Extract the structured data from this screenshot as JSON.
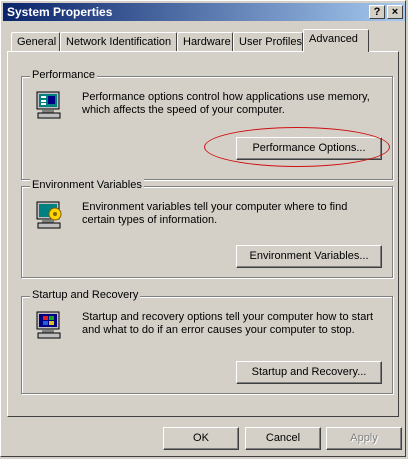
{
  "window": {
    "title": "System Properties",
    "help_label": "?",
    "close_label": "×"
  },
  "tabs": [
    {
      "label": "General"
    },
    {
      "label": "Network Identification"
    },
    {
      "label": "Hardware"
    },
    {
      "label": "User Profiles"
    },
    {
      "label": "Advanced"
    }
  ],
  "active_tab": "Advanced",
  "performance": {
    "title": "Performance",
    "description": "Performance options control how applications use memory, which affects the speed of your computer.",
    "button": "Performance Options..."
  },
  "environment": {
    "title": "Environment Variables",
    "description": "Environment variables tell your computer where to find certain types of information.",
    "button": "Environment Variables..."
  },
  "startup": {
    "title": "Startup and Recovery",
    "description": "Startup and recovery options tell your computer how to start and what to do if an error causes your computer to stop.",
    "button": "Startup and Recovery..."
  },
  "footer": {
    "ok": "OK",
    "cancel": "Cancel",
    "apply": "Apply"
  },
  "annotation_color": "#d01010"
}
